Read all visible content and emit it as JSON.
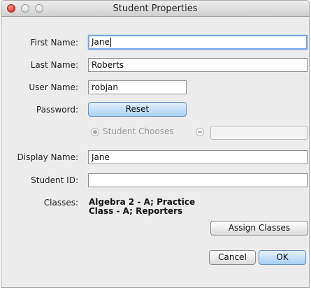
{
  "window": {
    "title": "Student Properties"
  },
  "form": {
    "first_name": {
      "label": "First Name:",
      "value": "Jane"
    },
    "last_name": {
      "label": "Last Name:",
      "value": "Roberts"
    },
    "user_name": {
      "label": "User Name:",
      "value": "robjan"
    },
    "password": {
      "label": "Password:",
      "button": "Reset"
    },
    "password_option": {
      "label": "Student Chooses",
      "custom_value": ""
    },
    "display_name": {
      "label": "Display Name:",
      "value": "Jane"
    },
    "student_id": {
      "label": "Student ID:",
      "value": ""
    },
    "classes": {
      "label": "Classes:",
      "line1": "Algebra 2 - A; Practice",
      "line2": "Class - A; Reporters"
    }
  },
  "buttons": {
    "assign_classes": "Assign Classes",
    "cancel": "Cancel",
    "ok": "OK"
  }
}
